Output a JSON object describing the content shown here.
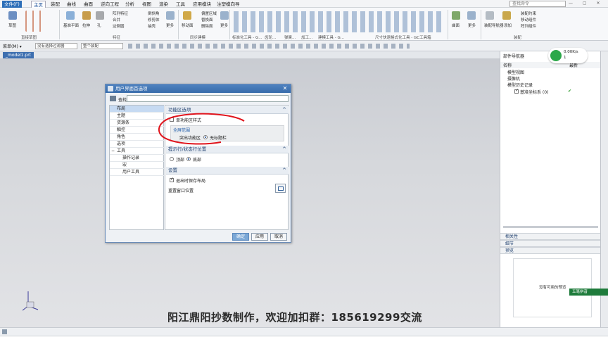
{
  "menu": [
    "文件(F)",
    "主页",
    "装配",
    "曲线",
    "曲面",
    "逆向工程",
    "分析",
    "视图",
    "渲染",
    "工具",
    "应用模块",
    "注塑模向导"
  ],
  "search_placeholder": "查找命令",
  "ribbon": {
    "groups": [
      "直接草图",
      "特征",
      "同步建模",
      "标准化工具 - G...",
      "齿轮...",
      "弹簧...",
      "加工...",
      "建模工具 - G...",
      "尺寸快速格式化工具 - GC工具箱",
      "装配"
    ],
    "labels": [
      "草图",
      "基准平面",
      "拉伸",
      "孔",
      "阵列特征",
      "合并",
      "边倒圆",
      "倒斜角",
      "修剪体",
      "抽壳",
      "更多",
      "移动面",
      "偏置区域",
      "替换面",
      "删除面",
      "更多",
      "曲面",
      "更多",
      "装配约束",
      "移动组件",
      "阵列组件",
      "添加",
      "装配导航器"
    ]
  },
  "toolbar2": {
    "menu_label": "菜单(M) ▾",
    "filter": "没有选择过滤器",
    "assembly": "整个装配"
  },
  "tab": {
    "model": "_model1.prt"
  },
  "dialog": {
    "title": "用户界面首选项",
    "find_label": "查找",
    "tree": [
      "布局",
      "主题",
      "资源条",
      "触控",
      "角色",
      "选项",
      "工具",
      "操作记录",
      "宏",
      "用户工具"
    ],
    "sections": {
      "ribbon_options": "功能区选项",
      "single_ribbon": "单功能区样式",
      "fullscreen": "全屏范围",
      "fullscreen_opt1": "突出功能区",
      "fullscreen_opt2": "无标题栏",
      "prompt_status": "提示行/状态行位置",
      "top": "顶部",
      "bottom": "底部",
      "settings": "设置",
      "save_layout": "退出时保存布局",
      "reset_window": "重置窗口位置"
    },
    "buttons": {
      "ok": "确定",
      "apply": "应用",
      "cancel": "取消"
    }
  },
  "navigator": {
    "title": "部件导航器",
    "col_name": "名称",
    "col_latest": "最新",
    "items": [
      "模型视图",
      "摄像机",
      "模型历史记录",
      "基准坐标系 (0)"
    ],
    "sections": [
      "相关性",
      "细节",
      "预览"
    ],
    "preview_empty": "没有可用的预览"
  },
  "net": {
    "speed": "0.00K/s",
    "count": "1"
  },
  "watermark": "阳江鼎阳抄数制作，欢迎加扣群：185619299交流",
  "wechat_label": "五笔拼音",
  "colors": {
    "accent": "#2d6fb8",
    "annotation": "#e0141c",
    "check": "#2a9a2a"
  }
}
